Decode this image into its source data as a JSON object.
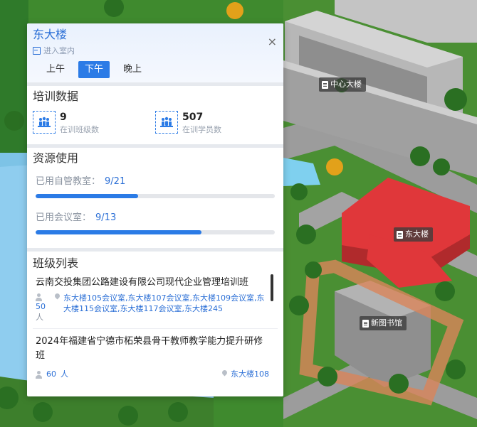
{
  "map": {
    "labels": [
      {
        "name": "中心大楼"
      },
      {
        "name": "东大楼"
      },
      {
        "name": "新图书馆"
      }
    ],
    "colors": {
      "grass": "#3f8a2e",
      "water": "#7dc3e6",
      "road": "#9a9a9a",
      "roof_red": "#e0373a"
    }
  },
  "panel": {
    "title": "东大楼",
    "enter_room": "进入室内",
    "close": "×",
    "tabs": [
      {
        "label": "上午",
        "active": false
      },
      {
        "label": "下午",
        "active": true
      },
      {
        "label": "晚上",
        "active": false
      }
    ],
    "training": {
      "title": "培训数据",
      "stats": [
        {
          "value": "9",
          "label": "在训班级数"
        },
        {
          "value": "507",
          "label": "在训学员数"
        }
      ]
    },
    "resources": {
      "title": "资源使用",
      "items": [
        {
          "label": "已用自管教室：",
          "value": "9/21",
          "fraction": 0.4286
        },
        {
          "label": "已用会议室：",
          "value": "9/13",
          "fraction": 0.6923
        }
      ]
    },
    "classes": {
      "title": "班级列表",
      "items": [
        {
          "name": "云南交投集团公路建设有限公司现代企业管理培训班",
          "count": "50",
          "unit": "人",
          "rooms": "东大楼105会议室,东大楼107会议室,东大楼109会议室,东大楼115会议室,东大楼117会议室,东大楼245"
        },
        {
          "name": "2024年福建省宁德市柘荣县骨干教师教学能力提升研修班",
          "count": "60",
          "unit": "人",
          "rooms": "东大楼108"
        }
      ]
    },
    "accent": "#2b7be6"
  }
}
